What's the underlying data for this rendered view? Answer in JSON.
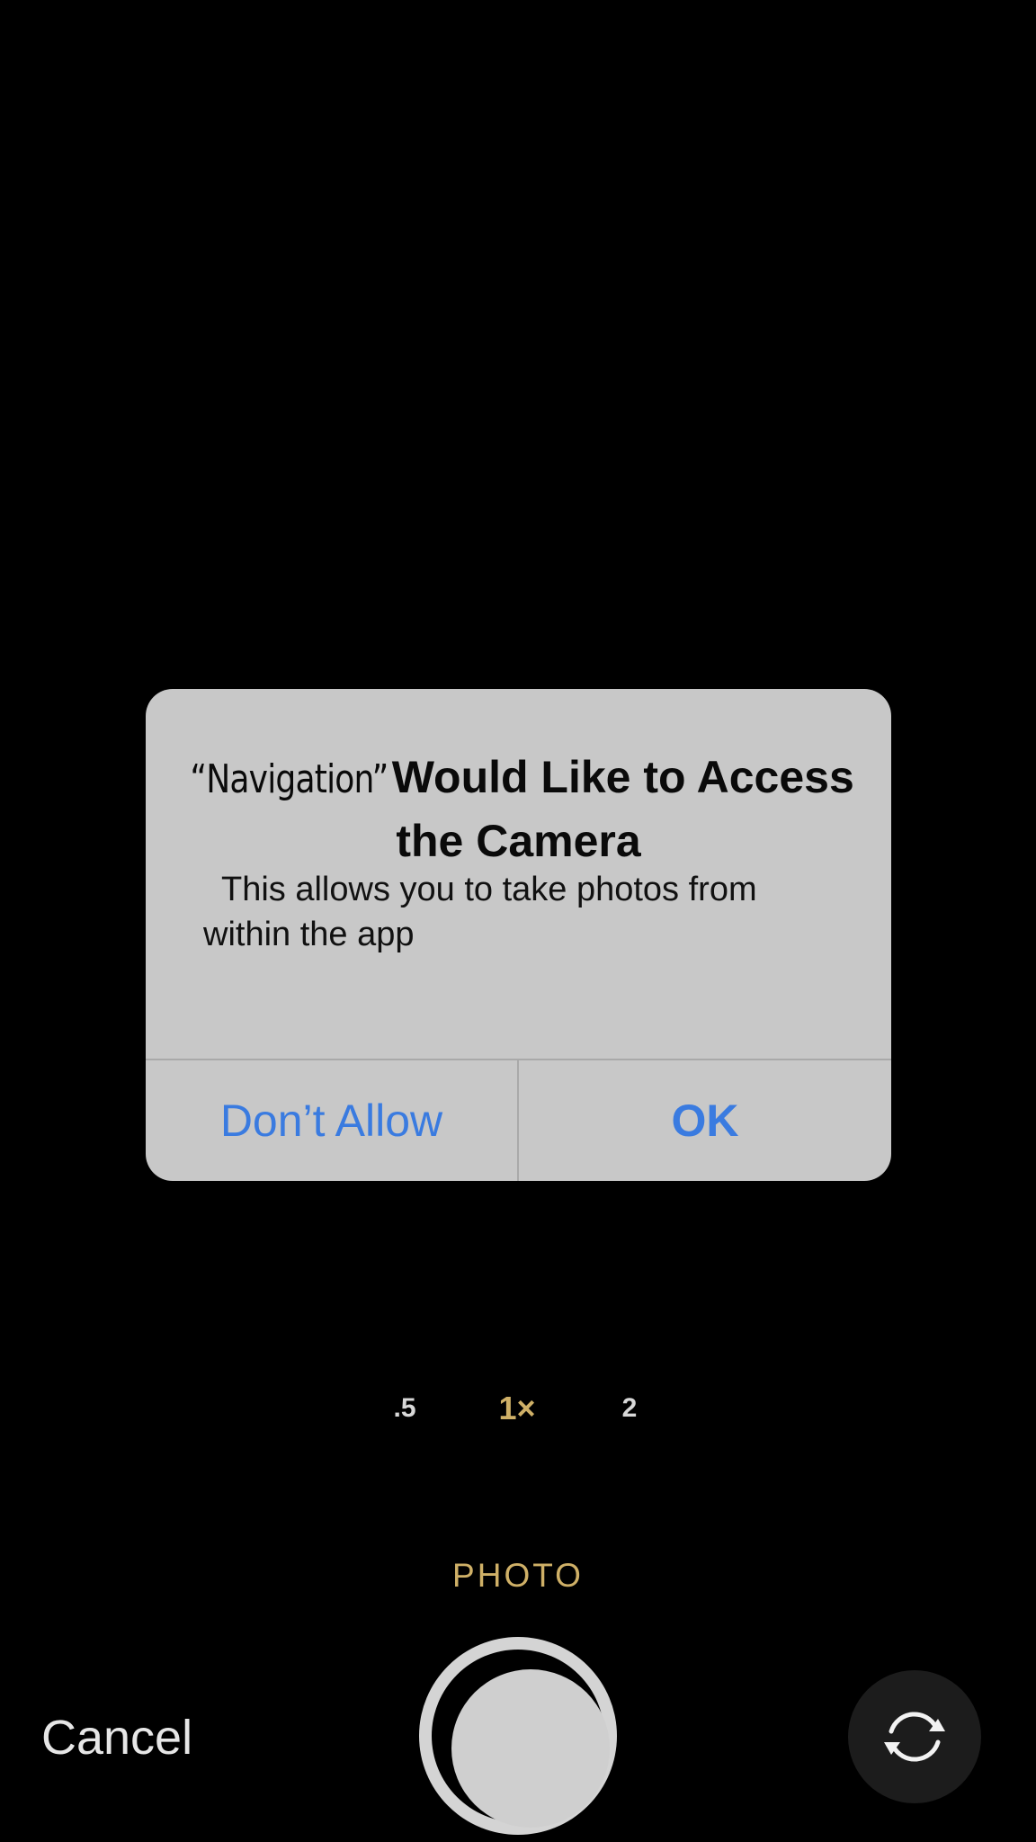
{
  "alert": {
    "app_name": "“Navigation”",
    "title": "Would Like to Access the Camera",
    "message": "This allows you to take photos from within the app",
    "deny_label": "Don’t Allow",
    "ok_label": "OK"
  },
  "camera": {
    "zoom_options": [
      ".5",
      "1×",
      "2"
    ],
    "selected_zoom": "1×",
    "mode": "PHOTO",
    "cancel_label": "Cancel"
  },
  "icons": {
    "shutter": "shutter-button",
    "flip": "camera-flip-icon"
  },
  "colors": {
    "background": "#000000",
    "alert_background": "#c8c8c8",
    "button_blue": "#3a7be0",
    "accent_yellow": "#cfb067",
    "text_light": "#e6e6e6"
  }
}
